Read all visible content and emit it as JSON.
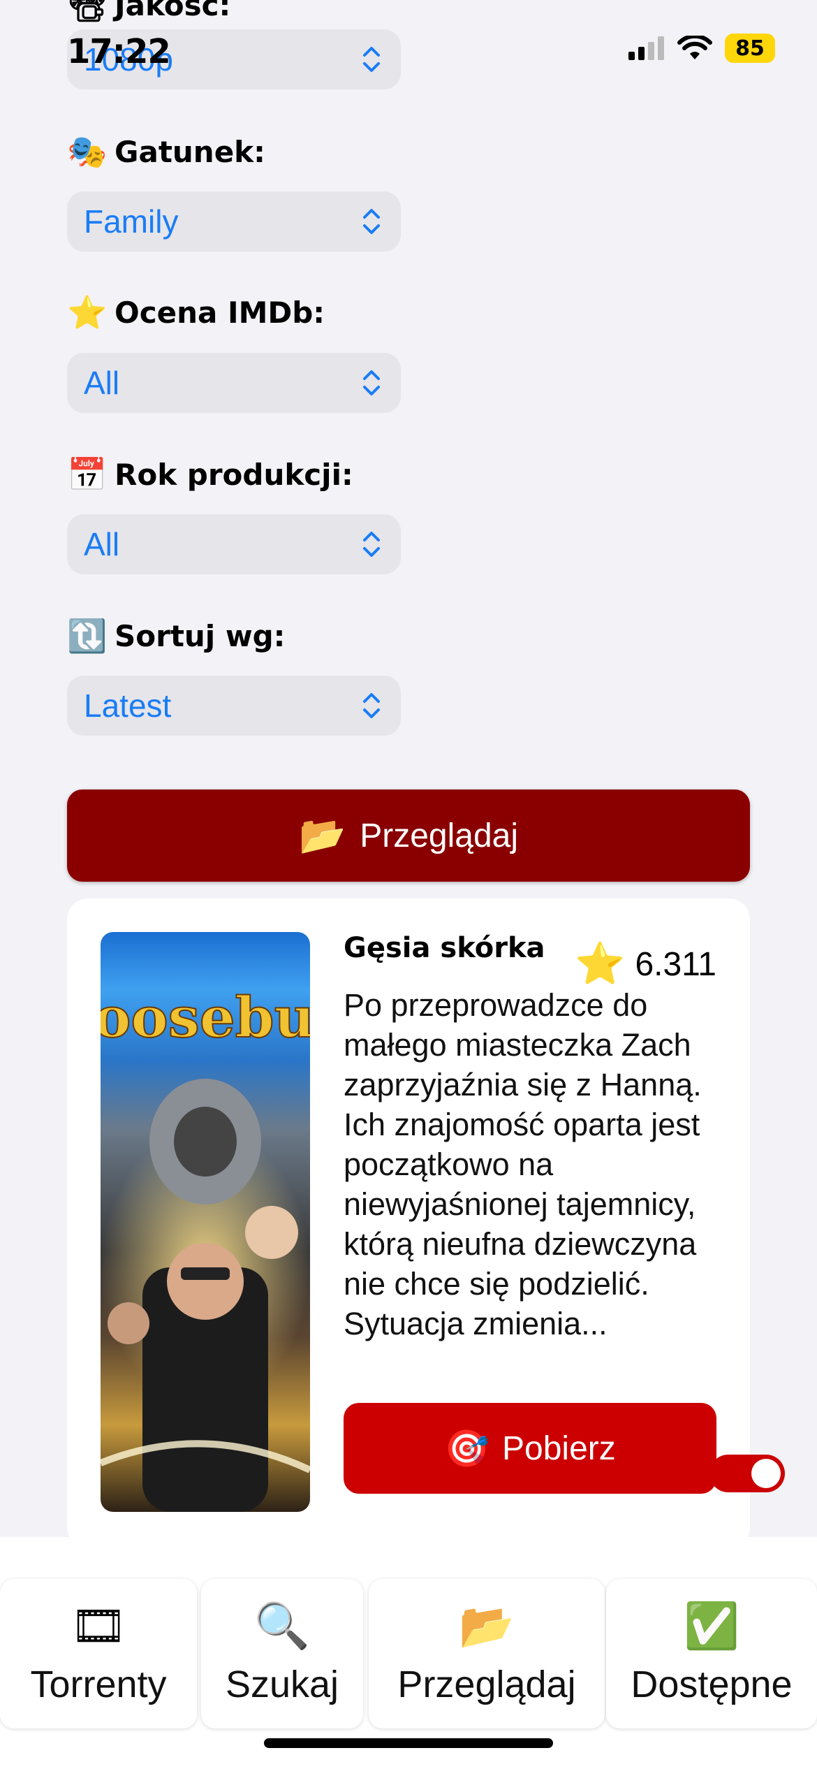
{
  "status": {
    "time": "17:22",
    "battery": "85"
  },
  "form": {
    "quality": {
      "label": "Jakość:",
      "value": "1080p"
    },
    "genre": {
      "label": "Gatunek:",
      "value": "Family"
    },
    "imdb": {
      "label": "Ocena IMDb:",
      "value": "All"
    },
    "year": {
      "label": "Rok produkcji:",
      "value": "All"
    },
    "sort": {
      "label": "Sortuj wg:",
      "value": "Latest"
    }
  },
  "browse_button": {
    "label": "Przeglądaj"
  },
  "movie": {
    "title": "Gęsia skórka",
    "rating": "6.311",
    "description": "Po przeprowadzce do małego miasteczka Zach zaprzyjaźnia się z Hanną. Ich znajomość oparta jest początkowo na niewyjaśnionej tajemnicy, którą nieufna dziewczyna nie chce się podzielić. Sytuacja zmienia...",
    "poster_text": "oosebum",
    "download_label": "Pobierz",
    "toggle_on": true
  },
  "tabs": [
    {
      "label": "Torrenty",
      "icon": "film-icon"
    },
    {
      "label": "Szukaj",
      "icon": "search-icon"
    },
    {
      "label": "Przeglądaj",
      "icon": "folder-icon"
    },
    {
      "label": "Dostępne",
      "icon": "check-icon"
    }
  ],
  "colors": {
    "accent_dark_red": "#8a0000",
    "accent_red": "#cc0000",
    "link_blue": "#1a7cf5"
  }
}
